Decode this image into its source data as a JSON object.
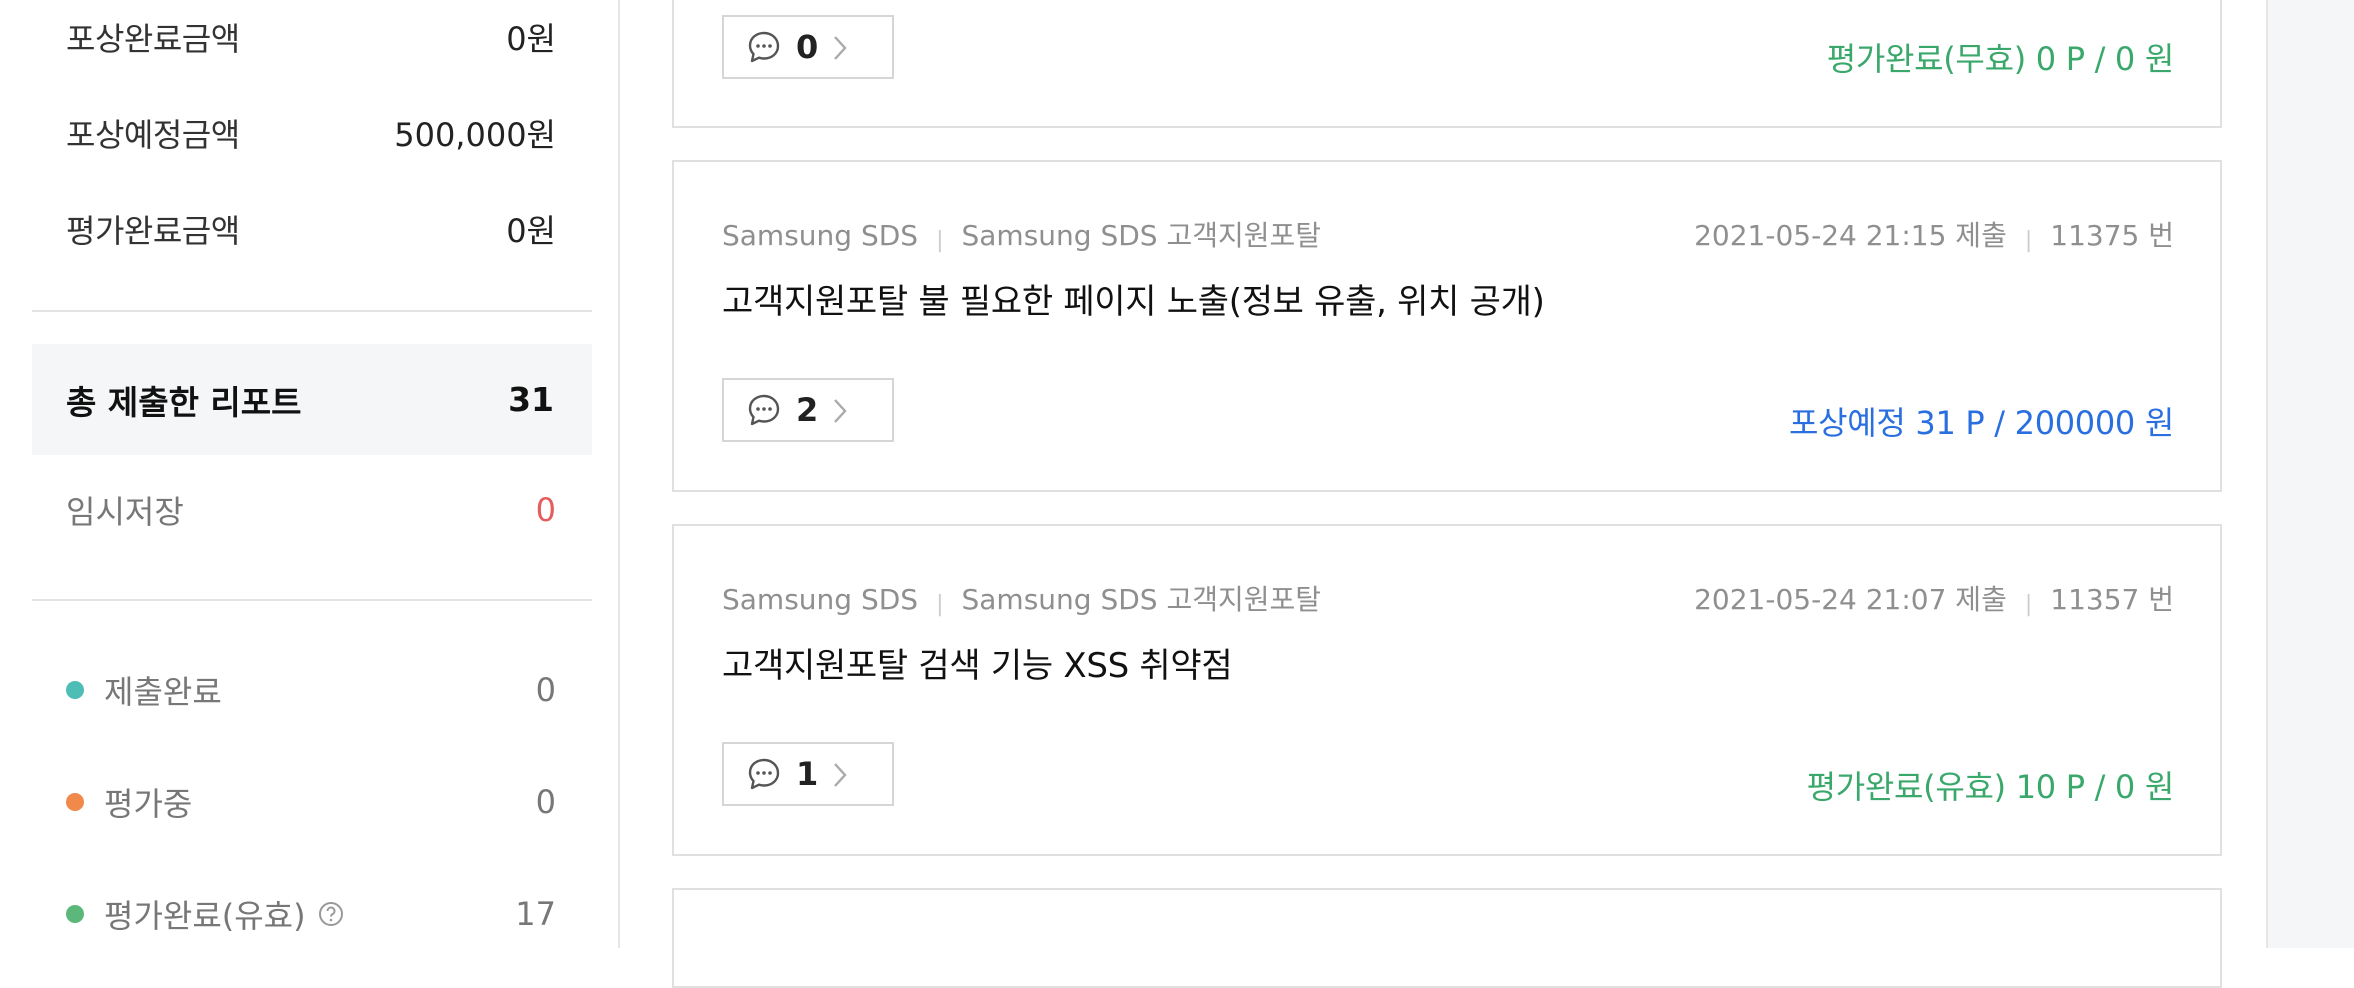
{
  "sidebar": {
    "summary": [
      {
        "label": "포상완료금액",
        "value": "0원"
      },
      {
        "label": "포상예정금액",
        "value": "500,000원"
      },
      {
        "label": "평가완료금액",
        "value": "0원"
      }
    ],
    "total": {
      "label": "총 제출한 리포트",
      "value": "31"
    },
    "temp": {
      "label": "임시저장",
      "value": "0"
    },
    "statuses": [
      {
        "label": "제출완료",
        "value": "0",
        "color": "#4dbdb5"
      },
      {
        "label": "평가중",
        "value": "0",
        "color": "#f0894a"
      },
      {
        "label": "평가완료(유효)",
        "value": "17",
        "color": "#5cb87a"
      }
    ]
  },
  "reports": [
    {
      "comments": "0",
      "status": "평가완료(무효) 0 P / 0 원",
      "status_color": "#3aa86b"
    },
    {
      "company": "Samsung SDS",
      "service": "Samsung SDS 고객지원포탈",
      "submitted": "2021-05-24 21:15 제출",
      "number": "11375 번",
      "title": "고객지원포탈 불 필요한 페이지 노출(정보 유출, 위치 공개)",
      "comments": "2",
      "status": "포상예정 31 P / 200000 원",
      "status_color": "#2a6fe0"
    },
    {
      "company": "Samsung SDS",
      "service": "Samsung SDS 고객지원포탈",
      "submitted": "2021-05-24 21:07 제출",
      "number": "11357 번",
      "title": "고객지원포탈 검색 기능 XSS 취약점",
      "comments": "1",
      "status": "평가완료(유효) 10 P / 0 원",
      "status_color": "#3aa86b"
    }
  ],
  "icons": {
    "comment": "comment-bubble-icon",
    "chevron": "chevron-right-icon",
    "help": "help-circle-icon"
  }
}
